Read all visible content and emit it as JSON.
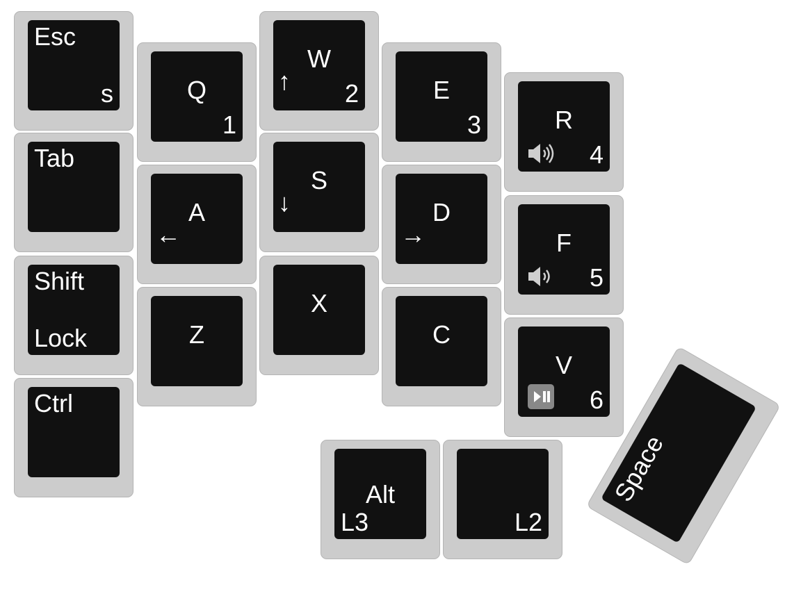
{
  "keys": [
    {
      "id": "esc",
      "tl": "Esc",
      "br": "s"
    },
    {
      "id": "tab",
      "tl": "Tab"
    },
    {
      "id": "shift",
      "tl": "Shift",
      "bl": "Lock"
    },
    {
      "id": "ctrl",
      "tl": "Ctrl"
    },
    {
      "id": "q",
      "tc": "Q",
      "br": "1"
    },
    {
      "id": "a",
      "tc": "A",
      "ml": "←"
    },
    {
      "id": "z",
      "tc": "Z"
    },
    {
      "id": "w",
      "tc": "W",
      "br": "2",
      "ml": "↑"
    },
    {
      "id": "s",
      "tc": "S",
      "ml": "↓"
    },
    {
      "id": "x",
      "tc": "X"
    },
    {
      "id": "e",
      "tc": "E",
      "br": "3"
    },
    {
      "id": "d",
      "tc": "D",
      "ml": "→"
    },
    {
      "id": "c",
      "tc": "C"
    },
    {
      "id": "r",
      "tc": "R",
      "br": "4",
      "icon": "volume-up-icon"
    },
    {
      "id": "f",
      "tc": "F",
      "br": "5",
      "icon": "volume-down-icon"
    },
    {
      "id": "v",
      "tc": "V",
      "br": "6",
      "icon": "play-pause-icon"
    },
    {
      "id": "alt",
      "tc": "Alt",
      "bl": "L3"
    },
    {
      "id": "l2",
      "br": "L2"
    },
    {
      "id": "space",
      "tl": "Space"
    }
  ],
  "colors": {
    "key_border": "#cccccc",
    "key_cap": "#111111",
    "legend": "#ffffff",
    "icon": "#cfcfcf"
  }
}
